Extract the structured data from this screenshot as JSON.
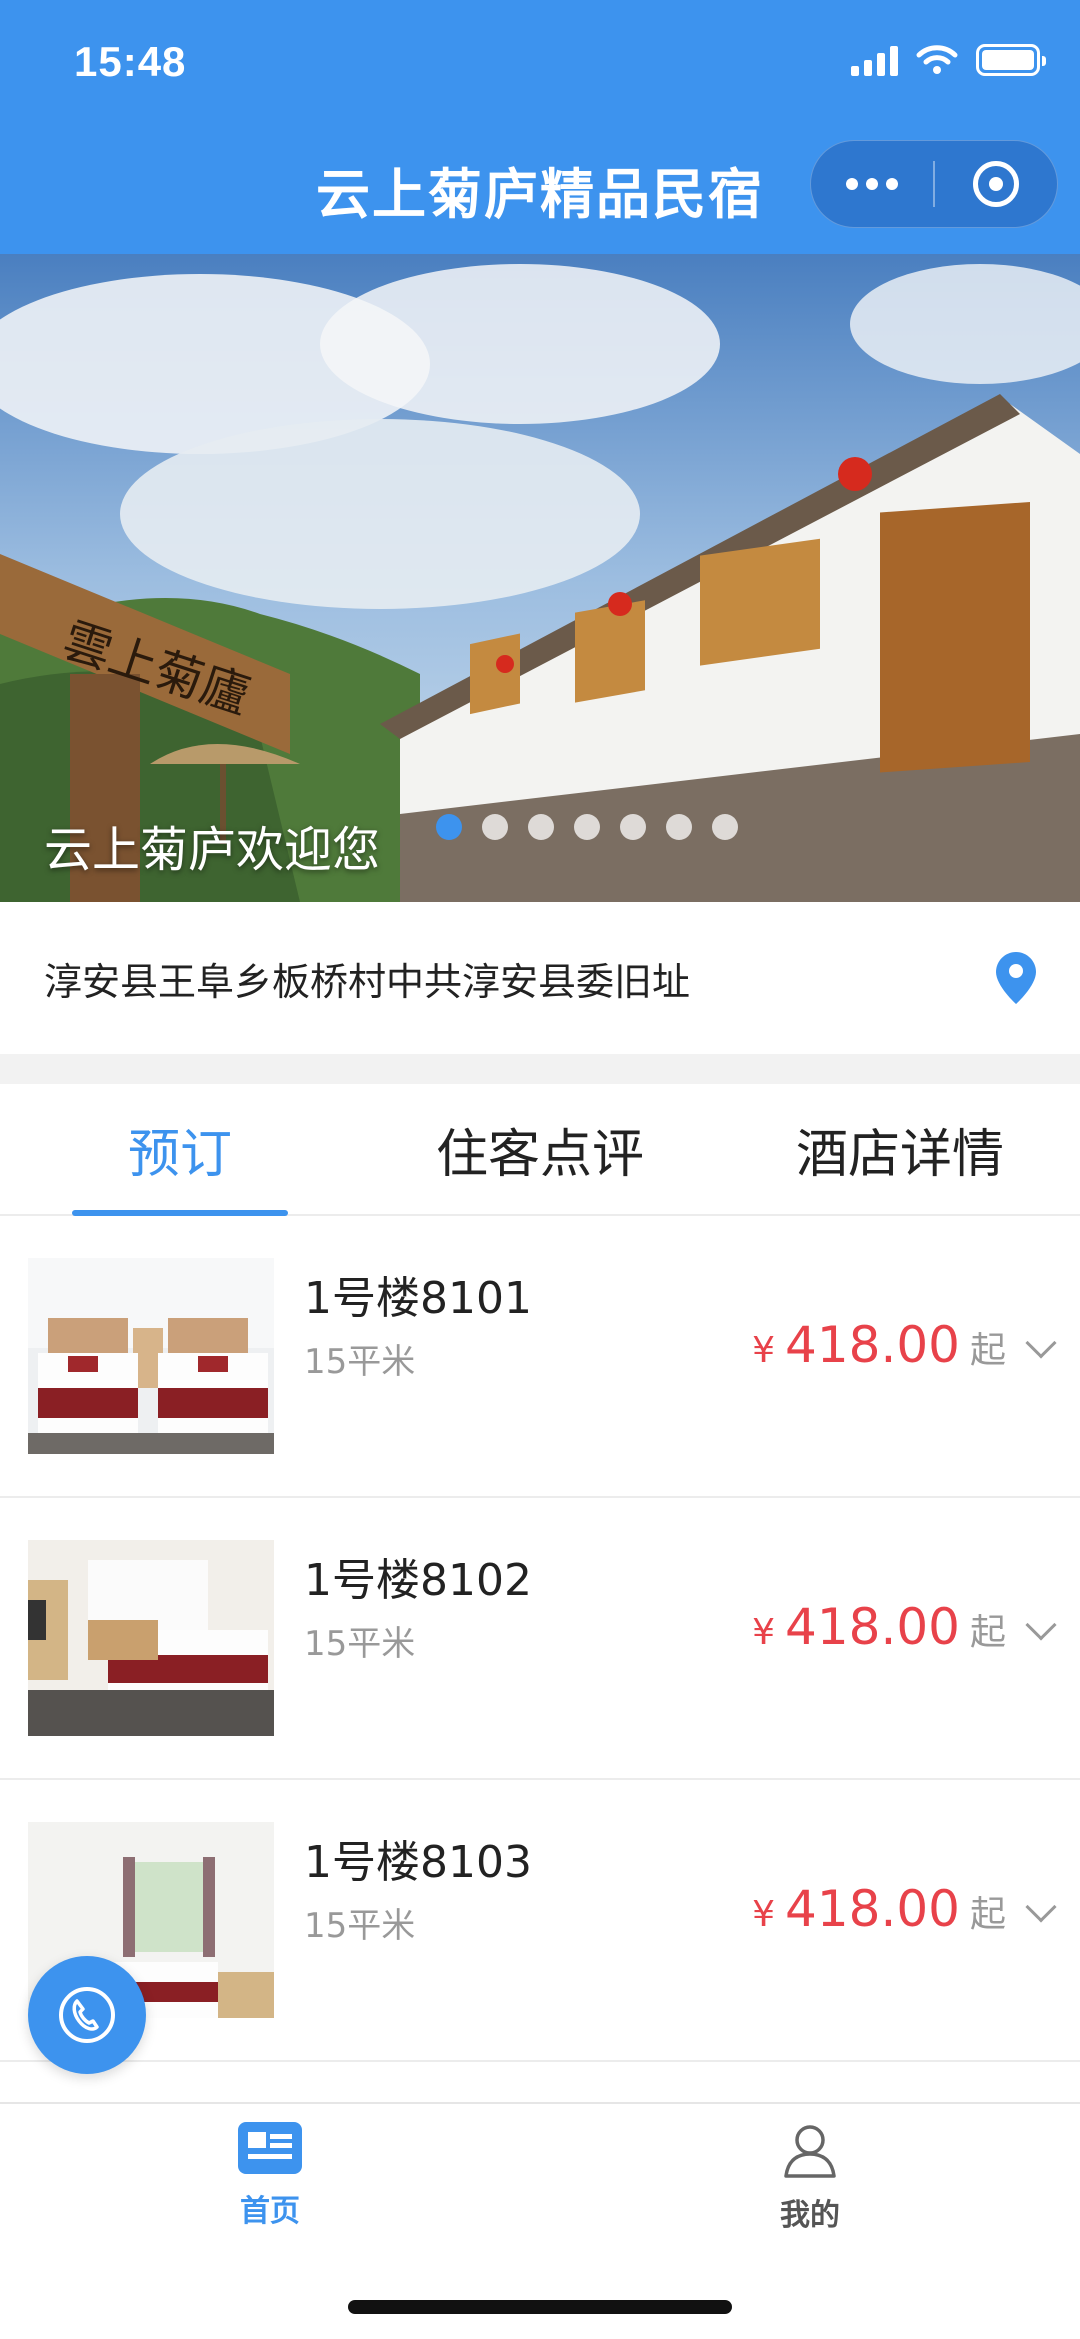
{
  "status_bar": {
    "time": "15:48"
  },
  "header": {
    "title": "云上菊庐精品民宿",
    "more_icon": "more-dots-icon",
    "close_icon": "target-circle-icon"
  },
  "banner": {
    "caption": "云上菊庐欢迎您",
    "slide_count": 7,
    "active_slide": 1,
    "sign_text": "雲上菊廬"
  },
  "address": {
    "text": "淳安县王阜乡板桥村中共淳安县委旧址",
    "icon": "location-pin-icon"
  },
  "tabs": [
    {
      "label": "预订",
      "active": true
    },
    {
      "label": "住客点评",
      "active": false
    },
    {
      "label": "酒店详情",
      "active": false
    }
  ],
  "rooms": [
    {
      "name": "1号楼8101",
      "area": "15平米",
      "currency": "¥",
      "price": "418.00",
      "suffix": "起"
    },
    {
      "name": "1号楼8102",
      "area": "15平米",
      "currency": "¥",
      "price": "418.00",
      "suffix": "起"
    },
    {
      "name": "1号楼8103",
      "area": "15平米",
      "currency": "¥",
      "price": "418.00",
      "suffix": "起"
    }
  ],
  "bottom_nav": [
    {
      "label": "首页",
      "icon": "news-icon",
      "active": true
    },
    {
      "label": "我的",
      "icon": "user-icon",
      "active": false
    }
  ],
  "colors": {
    "primary": "#3d93ee",
    "price": "#e8424a",
    "muted": "#999999"
  }
}
